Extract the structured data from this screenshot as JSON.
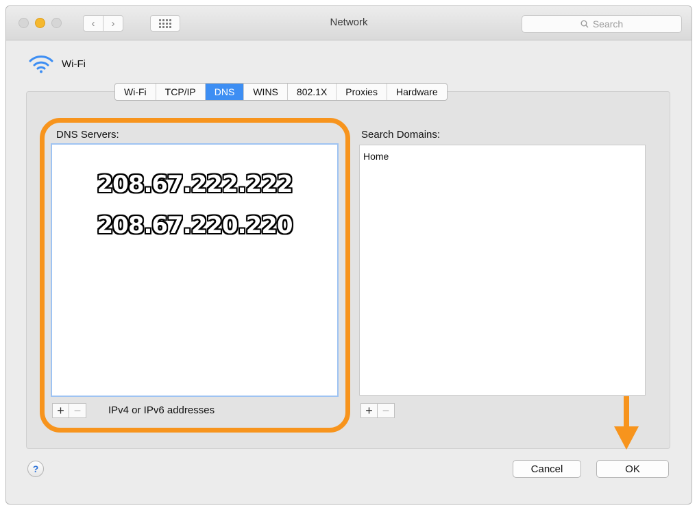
{
  "window": {
    "title": "Network",
    "search_placeholder": "Search",
    "nav_back": "‹",
    "nav_forward": "›"
  },
  "interface": {
    "name": "Wi-Fi",
    "icon": "wifi-icon"
  },
  "tabs": [
    {
      "label": "Wi-Fi",
      "active": false
    },
    {
      "label": "TCP/IP",
      "active": false
    },
    {
      "label": "DNS",
      "active": true
    },
    {
      "label": "WINS",
      "active": false
    },
    {
      "label": "802.1X",
      "active": false
    },
    {
      "label": "Proxies",
      "active": false
    },
    {
      "label": "Hardware",
      "active": false
    }
  ],
  "dns": {
    "label": "DNS Servers:",
    "servers": [
      "208.67.222.222",
      "208.67.220.220"
    ],
    "hint": "IPv4 or IPv6 addresses",
    "plus": "+",
    "minus": "−"
  },
  "search_domains": {
    "label": "Search Domains:",
    "items": [
      "Home"
    ],
    "plus": "+",
    "minus": "−"
  },
  "footer": {
    "help": "?",
    "cancel": "Cancel",
    "ok": "OK"
  },
  "colors": {
    "highlight": "#f7941d",
    "tab_active": "#3d8ef3",
    "traffic_yellow": "#f5b82e"
  }
}
